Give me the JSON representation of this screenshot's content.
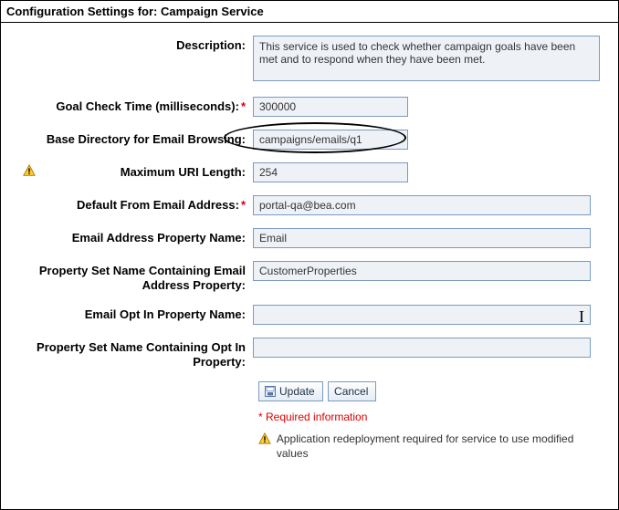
{
  "titlebar": "Configuration Settings for: Campaign Service",
  "fields": {
    "description": {
      "label": "Description:",
      "value": "This service is used to check whether campaign goals have been met and to respond when they have been met."
    },
    "goal_check_time": {
      "label": "Goal Check Time (milliseconds):",
      "value": "300000",
      "required": true
    },
    "base_dir_email": {
      "label": "Base Directory for Email Browsing:",
      "value": "campaigns/emails/q1"
    },
    "max_uri": {
      "label": "Maximum URI Length:",
      "value": "254",
      "warn": true
    },
    "default_from": {
      "label": "Default From Email Address:",
      "value": "portal-qa@bea.com",
      "required": true
    },
    "email_prop_name": {
      "label": "Email Address Property Name:",
      "value": "Email"
    },
    "pset_email": {
      "label": "Property Set Name Containing Email Address Property:",
      "value": "CustomerProperties"
    },
    "email_optin": {
      "label": "Email Opt In Property Name:",
      "value": ""
    },
    "pset_optin": {
      "label": "Property Set Name Containing Opt In Property:",
      "value": ""
    }
  },
  "buttons": {
    "update": "Update",
    "cancel": "Cancel"
  },
  "notes": {
    "required": "* Required information",
    "redeploy": "Application redeployment required for service to use modified values"
  },
  "icons": {
    "warning": "warning-icon",
    "save": "save-icon"
  }
}
